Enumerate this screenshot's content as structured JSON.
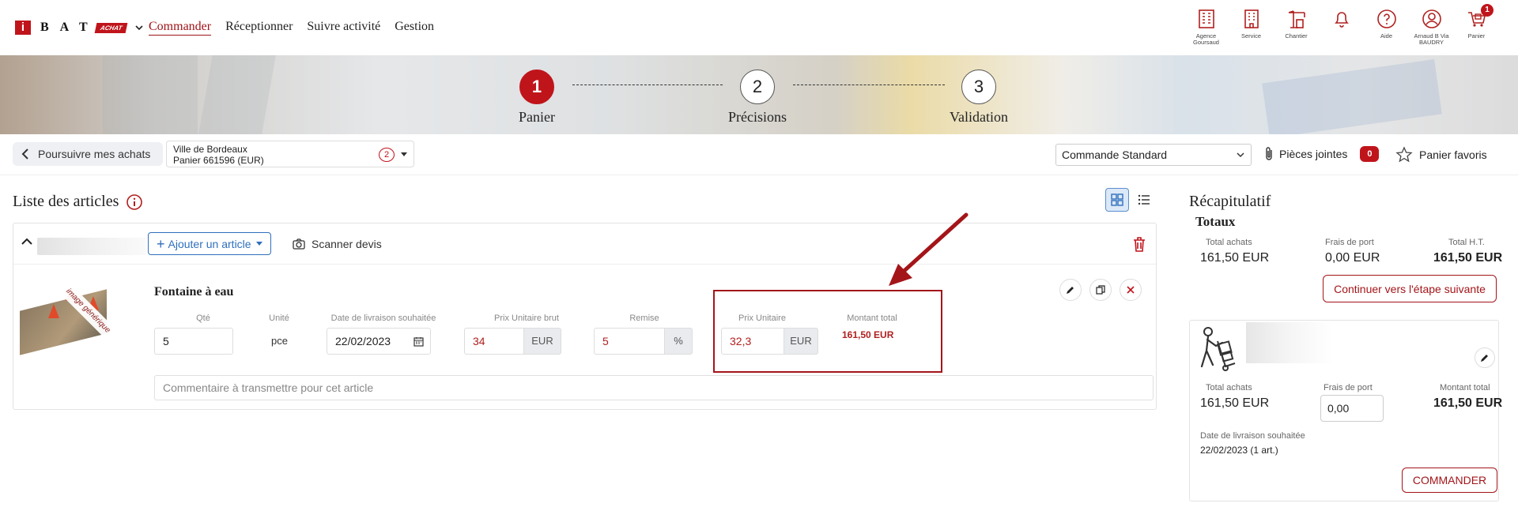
{
  "header": {
    "logo_i": "i",
    "logo_letters": "BAT",
    "logo_badge": "ACHAT",
    "nav": [
      "Commander",
      "Réceptionner",
      "Suivre activité",
      "Gestion"
    ],
    "icons": [
      {
        "name": "agence-icon",
        "label": "Agence Goursaud"
      },
      {
        "name": "service-icon",
        "label": "Service"
      },
      {
        "name": "chantier-icon",
        "label": "Chantier"
      },
      {
        "name": "bell-icon",
        "label": ""
      },
      {
        "name": "help-icon",
        "label": "Aide"
      },
      {
        "name": "user-icon",
        "label": "Arnaud B Via BAUDRY"
      },
      {
        "name": "cart-icon",
        "label": "Panier"
      }
    ],
    "cart_count": "1"
  },
  "steps": [
    {
      "num": "1",
      "label": "Panier"
    },
    {
      "num": "2",
      "label": "Précisions"
    },
    {
      "num": "3",
      "label": "Validation"
    }
  ],
  "subbar": {
    "back": "Poursuivre mes achats",
    "cart_line1": "Ville de Bordeaux",
    "cart_line2": "Panier 661596 (EUR)",
    "cart_count": "2",
    "order_type": "Commande Standard",
    "attachments": "Pièces jointes",
    "attachments_count": "0",
    "favorites": "Panier favoris"
  },
  "articles": {
    "title": "Liste des articles",
    "add_label": "Ajouter un article",
    "scan_label": "Scanner devis",
    "item": {
      "image_ribbon": "image générique",
      "name": "Fontaine à eau",
      "labels": {
        "qty": "Qté",
        "unit": "Unité",
        "date": "Date de livraison souhaitée",
        "gross": "Prix Unitaire brut",
        "discount": "Remise",
        "unit_price": "Prix Unitaire",
        "total": "Montant total"
      },
      "qty": "5",
      "unit": "pce",
      "date": "22/02/2023",
      "gross": "34",
      "gross_currency": "EUR",
      "discount": "5",
      "discount_unit": "%",
      "unit_price": "32,3",
      "unit_price_currency": "EUR",
      "total": "161,50 EUR",
      "comment_placeholder": "Commentaire à transmettre pour cet article"
    }
  },
  "recap": {
    "title": "Récapitulatif",
    "totals_title": "Totaux",
    "labels": {
      "total_purchases": "Total achats",
      "shipping": "Frais de port",
      "total_ht": "Total H.T."
    },
    "total_purchases": "161,50 EUR",
    "shipping": "0,00 EUR",
    "total_ht": "161,50 EUR",
    "continue_btn": "Continuer vers l'étape suivante",
    "supplier": {
      "labels": {
        "total_purchases": "Total achats",
        "shipping": "Frais de port",
        "total": "Montant total",
        "date": "Date de livraison souhaitée"
      },
      "total_purchases": "161,50 EUR",
      "shipping": "0,00",
      "total": "161,50 EUR",
      "date": "22/02/2023 (1 art.)",
      "order_btn": "COMMANDER"
    }
  },
  "colors": {
    "brand_red": "#c0141b",
    "link_blue": "#2f6fbd"
  }
}
